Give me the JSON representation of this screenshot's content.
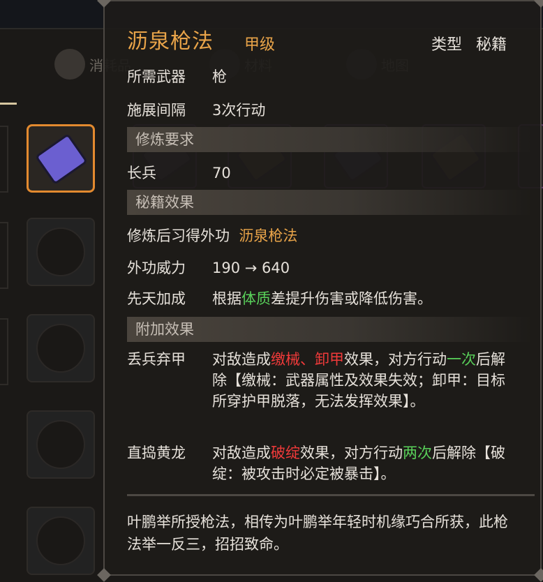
{
  "background": {
    "tabs": [
      {
        "label": "消耗品",
        "icon": "potion-icon"
      },
      {
        "label": "材料",
        "icon": "material-icon"
      },
      {
        "label": "地图",
        "icon": "map-icon"
      }
    ]
  },
  "tooltip": {
    "name": "沥泉枪法",
    "grade": "甲级",
    "type_label": "类型",
    "type_value": "秘籍",
    "weapon_label": "所需武器",
    "weapon_value": "枪",
    "interval_label": "施展间隔",
    "interval_value": "3次行动",
    "req_section": "修炼要求",
    "req_label": "长兵",
    "req_value": "70",
    "effect_section": "秘籍效果",
    "learn_label": "修炼后习得外功",
    "learn_value": "沥泉枪法",
    "power_label": "外功威力",
    "power_value": "190 → 640",
    "innate_label": "先天加成",
    "innate_pre": "根据",
    "innate_attr": "体质",
    "innate_post": "差提升伤害或降低伤害。",
    "extra_section": "附加效果",
    "effect1": {
      "label": "丢兵弃甲",
      "p1": "对敌造成",
      "k1": "缴械",
      "sep": "、",
      "k2": "卸甲",
      "p2": "效果，对方行动",
      "count": "一次",
      "p3": "后解除【缴械：武器属性及效果失效；卸甲：目标所穿护甲脱落，无法发挥效果】。"
    },
    "effect2": {
      "label": "直捣黄龙",
      "p1": "对敌造成",
      "k1": "破绽",
      "p2": "效果，对方行动",
      "count": "两次",
      "p3": "后解除【破绽：被攻击时必定被暴击】。"
    },
    "description": "叶鹏举所授枪法，相传为叶鹏举年轻时机缘巧合所获，此枪法举一反三，招招致命。"
  },
  "colors": {
    "title": "#e9a449",
    "green": "#59d15a",
    "red": "#f03a3a",
    "selected_border": "#e38a2f"
  }
}
